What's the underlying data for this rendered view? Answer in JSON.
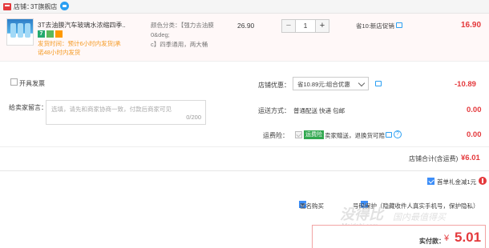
{
  "shop": {
    "label": "店铺：",
    "name": "3T旗舰店"
  },
  "product": {
    "title": "3T去油膜汽车玻璃水浓缩四季...",
    "shipping_line1": "发货时间：预计6小时内发货|承",
    "shipping_line2": "诺48小时内发货",
    "sku_line1": "颜色分类：【强力去油膜0&deg;",
    "sku_line2": "c】四季通用，两大桶",
    "unit_price": "26.90",
    "quantity": "1",
    "qty_minus": "−",
    "qty_plus": "+",
    "promotion": "省10:新店促销",
    "line_total": "16.90",
    "badge_text": "7"
  },
  "order": {
    "invoice_label": "开具发票",
    "note_label": "给卖家留言：",
    "note_placeholder": "选填，请先和商家协商一致，付款后商家可见",
    "note_counter": "0/200",
    "coupon_label": "店铺优惠：",
    "coupon_value": "省10.89元:组合优惠",
    "coupon_amount": "-10.89",
    "shipping_method_label": "运送方式：",
    "shipping_method_value": "普通配送 快递 包邮",
    "shipping_amount": "0.00",
    "insurance_label": "运费险：",
    "insurance_tag": "运费险",
    "insurance_text": "卖家赠送，退换货可赔",
    "insurance_amount": "0.00",
    "insurance_help": "?",
    "shop_total_label": "店铺合计(含运费)",
    "shop_total": "¥6.01"
  },
  "checkout": {
    "redpack_label": "首单礼金减1元",
    "anonymous_label": "匿名购买",
    "privacy_label": "号码保护（隐藏收件人真实手机号，保护隐私）",
    "pay_label": "实付款：",
    "pay_currency": "¥",
    "pay_amount": "5.01"
  },
  "watermark": {
    "main": "没得比",
    "sub": "Meidebi.com",
    "slogan": "国内最值得买"
  }
}
